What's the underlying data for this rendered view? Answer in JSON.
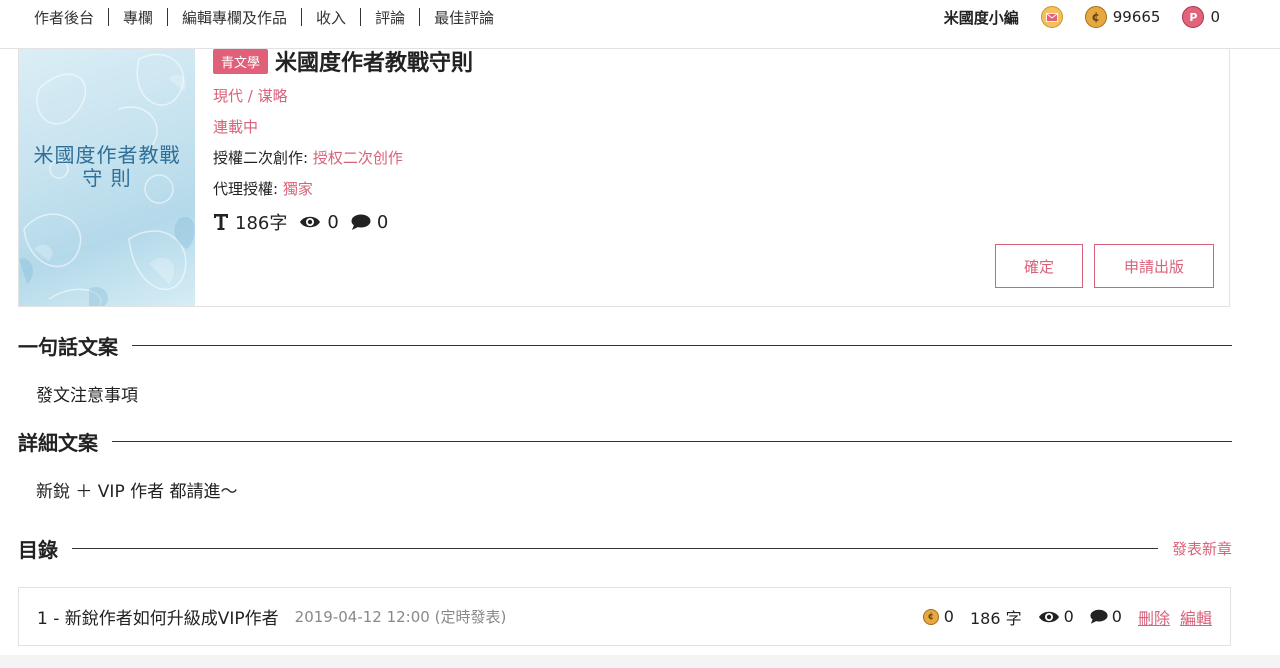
{
  "nav": {
    "items": [
      "作者後台",
      "專欄",
      "編輯專欄及作品",
      "收入",
      "評論",
      "最佳評論"
    ],
    "username": "米國度小編",
    "coins": "99665",
    "points": "0"
  },
  "book": {
    "genre_tag": "青文學",
    "title": "米國度作者教戰守則",
    "cover_text_line1": "米國度作者教戰",
    "cover_text_line2": "守 則",
    "category": "現代 / 谋略",
    "status": "連載中",
    "derivative_label": "授權二次創作:",
    "derivative_value": "授权二次创作",
    "agency_label": "代理授權:",
    "agency_value": "獨家",
    "word_count": "186字",
    "views": "0",
    "comments": "0",
    "confirm_label": "確定",
    "publish_label": "申請出版"
  },
  "sections": {
    "tagline_title": "一句話文案",
    "tagline_text": "發文注意事項",
    "detail_title": "詳細文案",
    "detail_text": "新銳 ＋ VIP 作者 都請進〜",
    "toc_title": "目錄",
    "new_chapter_label": "發表新章"
  },
  "chapters": [
    {
      "title": "1 - 新銳作者如何升級成VIP作者",
      "date": "2019-04-12 12:00 (定時發表)",
      "coins": "0",
      "words": "186 字",
      "views": "0",
      "comments": "0",
      "delete_label": "刪除",
      "edit_label": "編輯"
    }
  ],
  "colors": {
    "accent": "#d9627a",
    "coin": "#e6a841",
    "cover_text": "#2f6f98"
  }
}
